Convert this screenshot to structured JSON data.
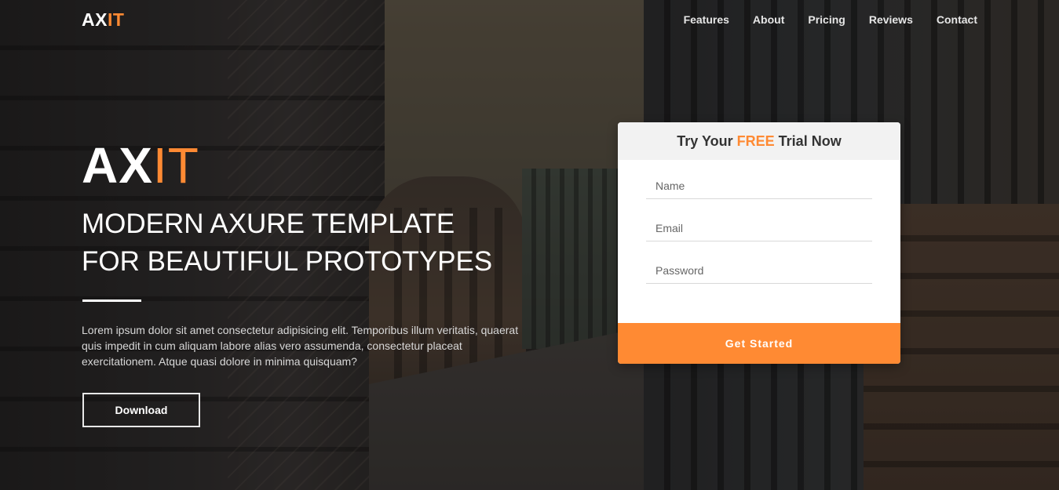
{
  "brand": {
    "logo_main": "AX",
    "logo_accent": "IT",
    "accent_color": "#ff8a33"
  },
  "nav": {
    "items": [
      {
        "label": "Features"
      },
      {
        "label": "About"
      },
      {
        "label": "Pricing"
      },
      {
        "label": "Reviews"
      },
      {
        "label": "Contact"
      }
    ]
  },
  "hero": {
    "title_main": "AX",
    "title_accent": "IT",
    "headline_line1": "MODERN AXURE TEMPLATE",
    "headline_line2": "FOR BEAUTIFUL PROTOTYPES",
    "description": "Lorem ipsum dolor sit amet consectetur adipisicing elit. Temporibus illum veritatis, quaerat quis impedit in cum aliquam labore alias vero assumenda, consectetur placeat exercitationem. Atque quasi dolore in minima quisquam?",
    "download_label": "Download"
  },
  "signup": {
    "heading_before": "Try Your ",
    "heading_accent": "FREE",
    "heading_after": " Trial Now",
    "name_placeholder": "Name",
    "email_placeholder": "Email",
    "password_placeholder": "Password",
    "submit_label": "Get Started"
  }
}
